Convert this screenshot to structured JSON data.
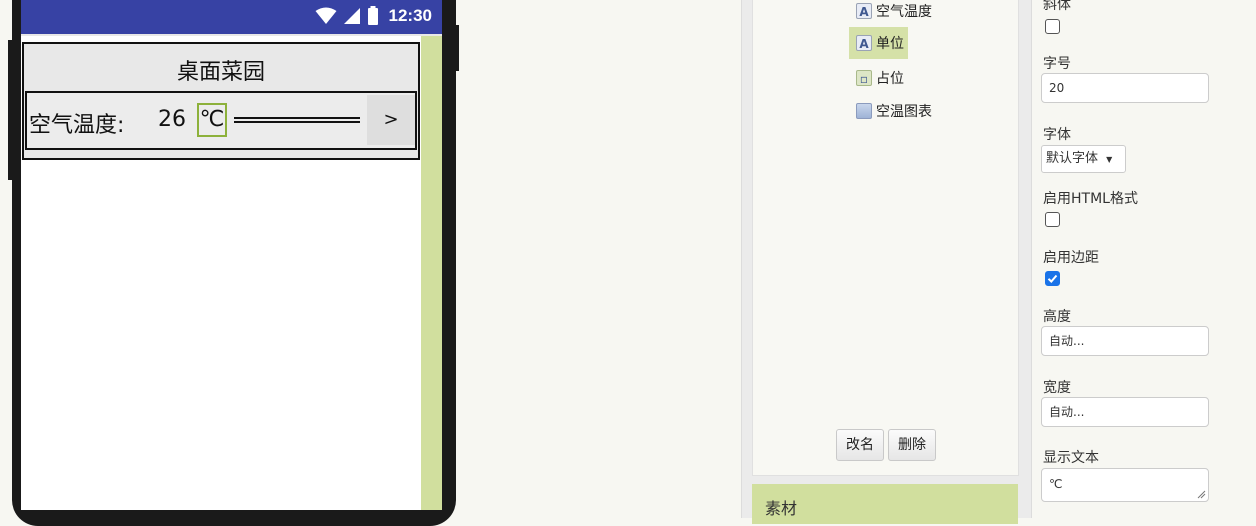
{
  "phone": {
    "clock": "12:30",
    "app_title": "桌面菜园",
    "row": {
      "label": "空气温度:",
      "value": "26",
      "unit": "℃",
      "button": ">"
    }
  },
  "components": {
    "items": [
      {
        "label": "空气温度",
        "icon": "label-icon"
      },
      {
        "label": "单位",
        "icon": "label-icon",
        "selected": true
      },
      {
        "label": "占位",
        "icon": "space-icon"
      },
      {
        "label": "空温图表",
        "icon": "chart-icon"
      }
    ],
    "rename_button": "改名",
    "delete_button": "删除",
    "assets_title": "素材"
  },
  "properties": {
    "italic_label": "斜体",
    "font_size_label": "字号",
    "font_size_value": "20",
    "font_family_label": "字体",
    "font_family_value": "默认字体",
    "html_format_label": "启用HTML格式",
    "margins_label": "启用边距",
    "height_label": "高度",
    "height_value": "自动...",
    "width_label": "宽度",
    "width_value": "自动...",
    "text_label": "显示文本",
    "text_value": "℃"
  },
  "colors": {
    "statusbar": "#3742a4",
    "accent_green": "#d1df9e",
    "selected_item": "#d5e1a8",
    "checkbox_checked": "#1a73e8"
  }
}
